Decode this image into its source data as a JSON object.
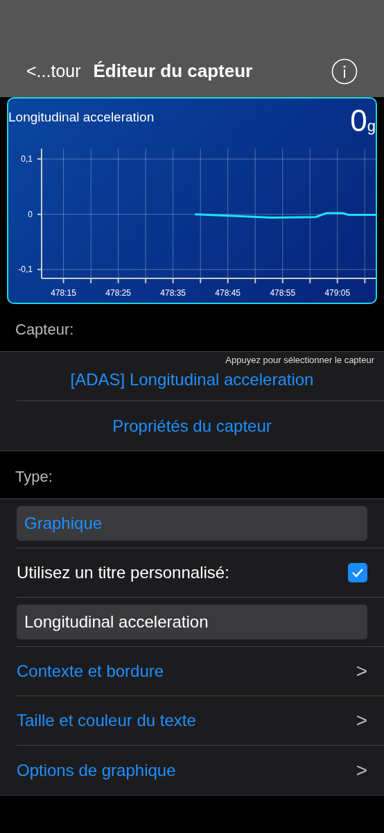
{
  "nav": {
    "back": "<...tour",
    "title": "Éditeur du capteur"
  },
  "widget": {
    "title": "Longitudinal acceleration",
    "value": "0",
    "unit": "g",
    "chart_data": {
      "type": "line",
      "x": [
        28719,
        28726,
        28733,
        28741,
        28743,
        28746,
        28747,
        28752
      ],
      "grid": true,
      "series": [
        {
          "color": "#19e3f0",
          "values": [
            0,
            -0.003,
            -0.006,
            -0.005,
            0.002,
            0.002,
            -0.001,
            -0.001
          ]
        }
      ],
      "xlim": [
        28691,
        28753
      ],
      "ylim": [
        -0.116,
        0.119
      ],
      "xticks": [
        {
          "value": 28695,
          "label": "478:15"
        },
        {
          "value": 28705,
          "label": "478:25"
        },
        {
          "value": 28715,
          "label": "478:35"
        },
        {
          "value": 28725,
          "label": "478:45"
        },
        {
          "value": 28735,
          "label": "478:55"
        },
        {
          "value": 28745,
          "label": "479:05"
        }
      ],
      "yticks": [
        {
          "value": 0.1,
          "label": "0,1"
        },
        {
          "value": 0,
          "label": "0"
        },
        {
          "value": -0.1,
          "label": "-0,1"
        }
      ]
    }
  },
  "sensor_section": {
    "header": "Capteur:",
    "hint": "Appuyez pour sélectionner le capteur",
    "sensor": "[ADAS] Longitudinal acceleration",
    "properties": "Propriétés du capteur"
  },
  "type_section": {
    "header": "Type:",
    "rows": [
      {
        "kind": "picker",
        "value": "Graphique"
      },
      {
        "kind": "checkbox",
        "label": "Utilisez un titre personnalisé:",
        "checked": true
      },
      {
        "kind": "text",
        "value": "Longitudinal acceleration"
      },
      {
        "kind": "link",
        "label": "Contexte et bordure",
        "chevron": ">"
      },
      {
        "kind": "link",
        "label": "Taille et couleur du texte",
        "chevron": ">"
      },
      {
        "kind": "link",
        "label": "Options de graphique",
        "chevron": ">"
      }
    ]
  }
}
